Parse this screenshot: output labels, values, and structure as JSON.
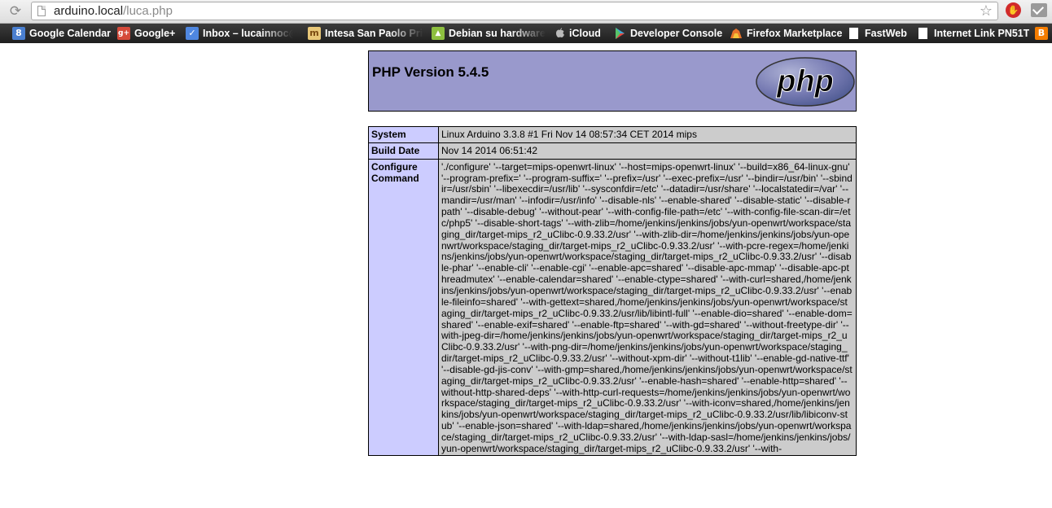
{
  "browser": {
    "url_host": "arduino.local",
    "url_path": "/luca.php",
    "bookmarks": [
      {
        "label": "Google Calendar",
        "icon": "google-calendar-icon",
        "color": "#4a7fd0",
        "glyph": "8"
      },
      {
        "label": "Google+",
        "icon": "google-plus-icon",
        "color": "#d54a3a",
        "glyph": "g+"
      },
      {
        "label": "Inbox – lucainnoc@g",
        "icon": "inbox-icon",
        "color": "#4f87e0",
        "glyph": "✓"
      },
      {
        "label": "Intesa San Paolo Pri",
        "icon": "intesa-icon",
        "color": "#e8c778",
        "glyph": "m"
      },
      {
        "label": "Debian su hardware",
        "icon": "android-icon",
        "color": "#8dbf3f",
        "glyph": "▲"
      },
      {
        "label": "iCloud",
        "icon": "apple-icon",
        "color": "#555555",
        "glyph": ""
      },
      {
        "label": "Developer Console",
        "icon": "google-play-icon",
        "color": "#3ea8d8",
        "glyph": "▶"
      },
      {
        "label": "Firefox Marketplace",
        "icon": "firefox-marketplace-icon",
        "color": "#e8742a",
        "glyph": "▲"
      },
      {
        "label": "FastWeb",
        "icon": "page-icon",
        "color": "#ffffff",
        "glyph": ""
      },
      {
        "label": "Internet Link PN51T",
        "icon": "page-icon",
        "color": "#ffffff",
        "glyph": ""
      },
      {
        "label": "",
        "icon": "blogger-icon",
        "color": "#f57d00",
        "glyph": "B"
      }
    ]
  },
  "php": {
    "title": "PHP Version 5.4.5",
    "logo_text": "php",
    "rows": [
      {
        "key": "System",
        "value": "Linux Arduino 3.3.8 #1 Fri Nov 14 08:57:34 CET 2014 mips"
      },
      {
        "key": "Build Date",
        "value": "Nov 14 2014 06:51:42"
      },
      {
        "key": "Configure Command",
        "value": "'./configure' '--target=mips-openwrt-linux' '--host=mips-openwrt-linux' '--build=x86_64-linux-gnu' '--program-prefix=' '--program-suffix=' '--prefix=/usr' '--exec-prefix=/usr' '--bindir=/usr/bin' '--sbindir=/usr/sbin' '--libexecdir=/usr/lib' '--sysconfdir=/etc' '--datadir=/usr/share' '--localstatedir=/var' '--mandir=/usr/man' '--infodir=/usr/info' '--disable-nls' '--enable-shared' '--disable-static' '--disable-rpath' '--disable-debug' '--without-pear' '--with-config-file-path=/etc' '--with-config-file-scan-dir=/etc/php5' '--disable-short-tags' '--with-zlib=/home/jenkins/jenkins/jobs/yun-openwrt/workspace/staging_dir/target-mips_r2_uClibc-0.9.33.2/usr' '--with-zlib-dir=/home/jenkins/jenkins/jobs/yun-openwrt/workspace/staging_dir/target-mips_r2_uClibc-0.9.33.2/usr' '--with-pcre-regex=/home/jenkins/jenkins/jobs/yun-openwrt/workspace/staging_dir/target-mips_r2_uClibc-0.9.33.2/usr' '--disable-phar' '--enable-cli' '--enable-cgi' '--enable-apc=shared' '--disable-apc-mmap' '--disable-apc-pthreadmutex' '--enable-calendar=shared' '--enable-ctype=shared' '--with-curl=shared,/home/jenkins/jenkins/jobs/yun-openwrt/workspace/staging_dir/target-mips_r2_uClibc-0.9.33.2/usr' '--enable-fileinfo=shared' '--with-gettext=shared,/home/jenkins/jenkins/jobs/yun-openwrt/workspace/staging_dir/target-mips_r2_uClibc-0.9.33.2/usr/lib/libintl-full' '--enable-dio=shared' '--enable-dom=shared' '--enable-exif=shared' '--enable-ftp=shared' '--with-gd=shared' '--without-freetype-dir' '--with-jpeg-dir=/home/jenkins/jenkins/jobs/yun-openwrt/workspace/staging_dir/target-mips_r2_uClibc-0.9.33.2/usr' '--with-png-dir=/home/jenkins/jenkins/jobs/yun-openwrt/workspace/staging_dir/target-mips_r2_uClibc-0.9.33.2/usr' '--without-xpm-dir' '--without-t1lib' '--enable-gd-native-ttf' '--disable-gd-jis-conv' '--with-gmp=shared,/home/jenkins/jenkins/jobs/yun-openwrt/workspace/staging_dir/target-mips_r2_uClibc-0.9.33.2/usr' '--enable-hash=shared' '--enable-http=shared' '--without-http-shared-deps' '--with-http-curl-requests=/home/jenkins/jenkins/jobs/yun-openwrt/workspace/staging_dir/target-mips_r2_uClibc-0.9.33.2/usr' '--with-iconv=shared,/home/jenkins/jenkins/jobs/yun-openwrt/workspace/staging_dir/target-mips_r2_uClibc-0.9.33.2/usr/lib/libiconv-stub' '--enable-json=shared' '--with-ldap=shared,/home/jenkins/jenkins/jobs/yun-openwrt/workspace/staging_dir/target-mips_r2_uClibc-0.9.33.2/usr' '--with-ldap-sasl=/home/jenkins/jenkins/jobs/yun-openwrt/workspace/staging_dir/target-mips_r2_uClibc-0.9.33.2/usr' '--with-"
      }
    ]
  }
}
